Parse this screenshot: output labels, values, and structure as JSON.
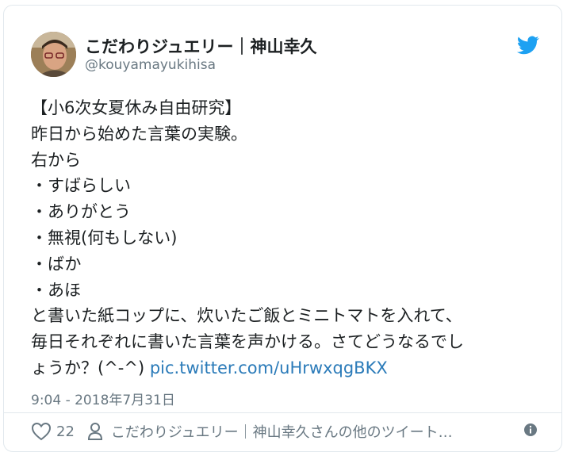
{
  "user": {
    "name": "こだわりジュエリー｜神山幸久",
    "handle": "@kouyamayukihisa"
  },
  "tweet": {
    "lines": [
      "【小6次女夏休み自由研究】",
      "昨日から始めた言葉の実験。",
      "右から",
      "・すばらしい",
      "・ありがとう",
      "・無視(何もしない)",
      "・ばか",
      "・あほ",
      "と書いた紙コップに、炊いたご飯とミニトマトを入れて、",
      "毎日それぞれに書いた言葉を声かける。さてどうなるでし"
    ],
    "last_line_text": "ょうか？(^-^) ",
    "link": "pic.twitter.com/uHrwxqgBKX"
  },
  "timestamp": "9:04 - 2018年7月31日",
  "actions": {
    "like_count": "22",
    "more_tweets": "こだわりジュエリー｜神山幸久さんの他のツイート…"
  },
  "icons": {
    "brand": "twitter-bird-icon",
    "like": "heart-icon",
    "profile": "person-icon",
    "info": "info-icon"
  },
  "colors": {
    "twitter_blue": "#1da1f2",
    "link": "#2b7bb9",
    "muted": "#697882",
    "border": "#e1e8ed"
  }
}
